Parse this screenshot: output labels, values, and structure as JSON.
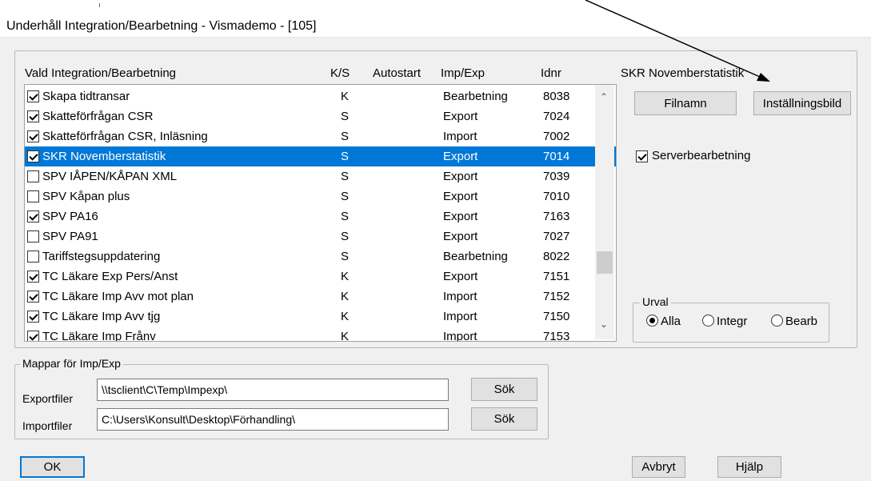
{
  "window": {
    "title": "Underhåll Integration/Bearbetning - Vismademo - [105]"
  },
  "list": {
    "headers": {
      "name": "Vald Integration/Bearbetning",
      "ks": "K/S",
      "autostart": "Autostart",
      "impexp": "Imp/Exp",
      "idnr": "Idnr"
    },
    "rows": [
      {
        "checked": true,
        "name": "Skapa tidtransar",
        "ks": "K",
        "type": "Bearbetning",
        "id": "8038",
        "selected": false
      },
      {
        "checked": true,
        "name": "Skatteförfrågan CSR",
        "ks": "S",
        "type": "Export",
        "id": "7024",
        "selected": false
      },
      {
        "checked": true,
        "name": "Skatteförfrågan CSR, Inläsning",
        "ks": "S",
        "type": "Import",
        "id": "7002",
        "selected": false
      },
      {
        "checked": true,
        "name": "SKR Novemberstatistik",
        "ks": "S",
        "type": "Export",
        "id": "7014",
        "selected": true
      },
      {
        "checked": false,
        "name": "SPV IÅPEN/KÅPAN XML",
        "ks": "S",
        "type": "Export",
        "id": "7039",
        "selected": false
      },
      {
        "checked": false,
        "name": "SPV Kåpan plus",
        "ks": "S",
        "type": "Export",
        "id": "7010",
        "selected": false
      },
      {
        "checked": true,
        "name": "SPV PA16",
        "ks": "S",
        "type": "Export",
        "id": "7163",
        "selected": false
      },
      {
        "checked": false,
        "name": "SPV PA91",
        "ks": "S",
        "type": "Export",
        "id": "7027",
        "selected": false
      },
      {
        "checked": false,
        "name": "Tariffstegsuppdatering",
        "ks": "S",
        "type": "Bearbetning",
        "id": "8022",
        "selected": false
      },
      {
        "checked": true,
        "name": "TC Läkare Exp Pers/Anst",
        "ks": "K",
        "type": "Export",
        "id": "7151",
        "selected": false
      },
      {
        "checked": true,
        "name": "TC Läkare Imp Avv mot plan",
        "ks": "K",
        "type": "Import",
        "id": "7152",
        "selected": false
      },
      {
        "checked": true,
        "name": "TC Läkare Imp Avv tjg",
        "ks": "K",
        "type": "Import",
        "id": "7150",
        "selected": false
      },
      {
        "checked": true,
        "name": "TC Läkare Imp Frånv",
        "ks": "K",
        "type": "Import",
        "id": "7153",
        "selected": false
      }
    ]
  },
  "right": {
    "header": "SKR Novemberstatistik",
    "filnamn_label": "Filnamn",
    "installningsbild_label": "Inställningsbild",
    "serverbearbetning_label": "Serverbearbetning",
    "serverbearbetning_checked": true,
    "urval": {
      "legend": "Urval",
      "options": [
        {
          "label": "Alla",
          "checked": true
        },
        {
          "label": "Integr",
          "checked": false
        },
        {
          "label": "Bearb",
          "checked": false
        }
      ]
    }
  },
  "folders": {
    "legend": "Mappar för Imp/Exp",
    "export_label": "Exportfiler",
    "export_value": "\\\\tsclient\\C\\Temp\\Impexp\\",
    "import_label": "Importfiler",
    "import_value": "C:\\Users\\Konsult\\Desktop\\Förhandling\\",
    "search_label": "Sök"
  },
  "footer": {
    "ok_label": "OK",
    "cancel_label": "Avbryt",
    "help_label": "Hjälp"
  },
  "colors": {
    "selection": "#0078d7",
    "dialog_bg": "#f0f0f0"
  }
}
